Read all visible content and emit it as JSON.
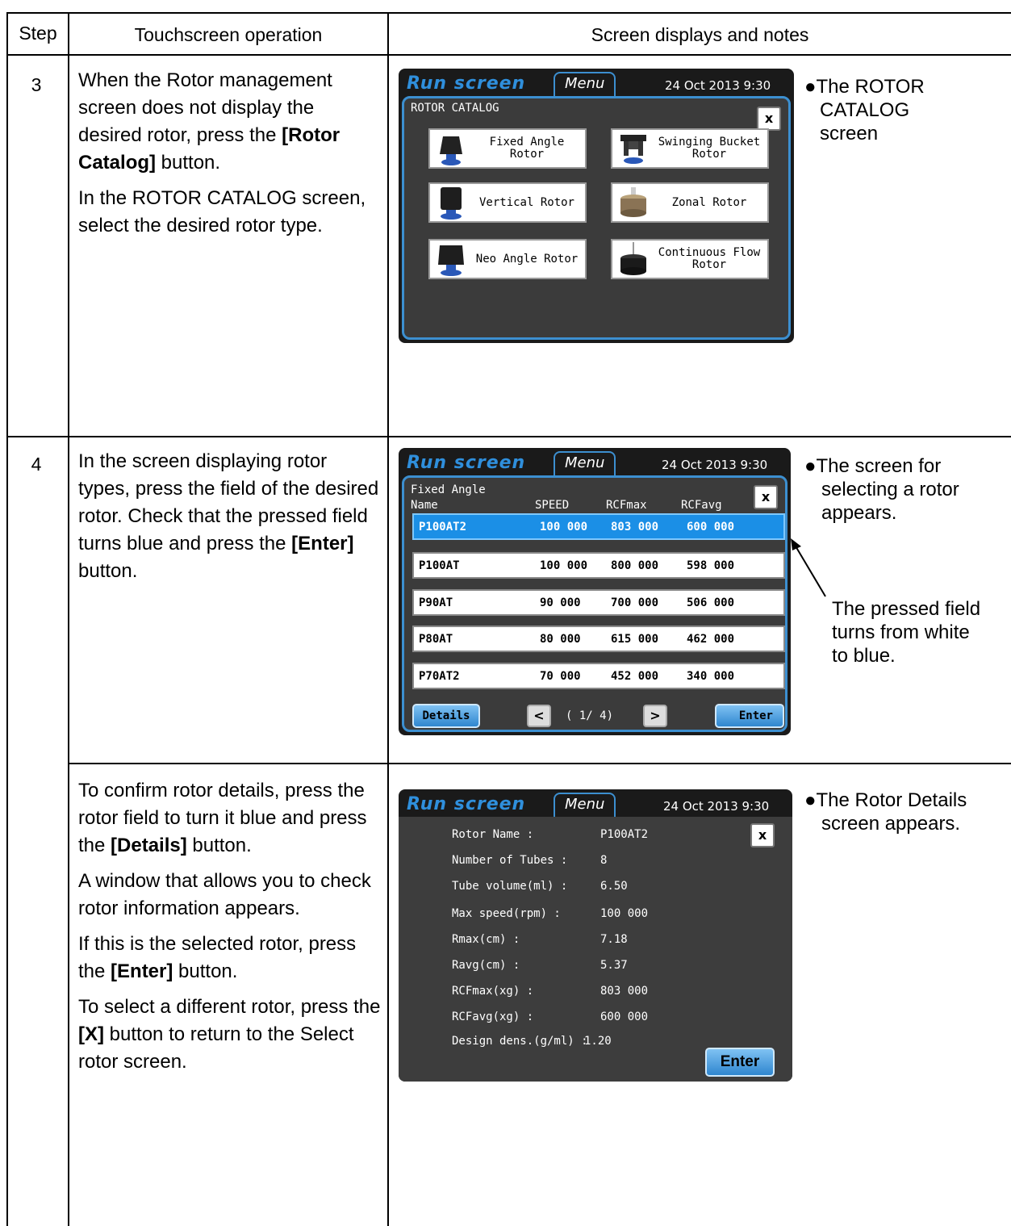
{
  "headers": {
    "step": "Step",
    "operation": "Touchscreen operation",
    "displays": "Screen displays and notes"
  },
  "rows": [
    {
      "step": "3",
      "instructions": [
        [
          "When the Rotor management screen does not display the desired rotor, press the ",
          {
            "b": "[Rotor Catalog]"
          },
          " button."
        ],
        [
          "In the ROTOR CATALOG screen, select the desired rotor type."
        ]
      ],
      "note_lines": [
        "●The ROTOR",
        "CATALOG",
        "screen"
      ]
    },
    {
      "step": "4",
      "instructions": [
        [
          "In the screen displaying rotor types, press the field of the desired rotor. Check that the pressed field turns blue and press the ",
          {
            "b": "[Enter]"
          },
          " button."
        ]
      ],
      "note_lines": [
        "●The screen for",
        "selecting a rotor",
        "appears."
      ],
      "arrow_note_lines": [
        "The pressed field",
        "turns from white",
        "to blue."
      ]
    },
    {
      "step": "",
      "instructions": [
        [
          "To confirm rotor details, press the rotor field to turn it blue and press the ",
          {
            "b": "[Details]"
          },
          " button."
        ],
        [
          "A window that allows you to check rotor information appears."
        ],
        [
          "If this is the selected rotor, press the ",
          {
            "b": "[Enter]"
          },
          " button."
        ],
        [
          "To select a different rotor, press the ",
          {
            "b": "[X]"
          },
          " button to return to the Select rotor screen."
        ]
      ],
      "note_lines": [
        "●The Rotor Details",
        "screen appears."
      ]
    }
  ],
  "screen_common": {
    "tab_run": "Run screen",
    "tab_menu": "Menu",
    "datetime": "24 Oct 2013  9:30",
    "close": "x"
  },
  "catalog": {
    "title": "ROTOR CATALOG",
    "buttons": [
      {
        "label": "Fixed Angle\nRotor",
        "icon": "fixed-angle-rotor-icon"
      },
      {
        "label": "Swinging Bucket\nRotor",
        "icon": "swinging-bucket-rotor-icon"
      },
      {
        "label": "Vertical Rotor",
        "icon": "vertical-rotor-icon"
      },
      {
        "label": "Zonal Rotor",
        "icon": "zonal-rotor-icon"
      },
      {
        "label": "Neo Angle Rotor",
        "icon": "neo-angle-rotor-icon"
      },
      {
        "label": "Continuous Flow\nRotor",
        "icon": "continuous-flow-rotor-icon"
      }
    ]
  },
  "select": {
    "title": "Fixed Angle",
    "columns": [
      "Name",
      "SPEED",
      "RCFmax",
      "RCFavg"
    ],
    "rows": [
      {
        "name": "P100AT2",
        "speed": "100 000",
        "rcfmax": "803 000",
        "rcfavg": "600 000",
        "selected": true
      },
      {
        "name": "P100AT",
        "speed": "100 000",
        "rcfmax": "800 000",
        "rcfavg": "598 000",
        "selected": false
      },
      {
        "name": "P90AT",
        "speed": "90 000",
        "rcfmax": "700 000",
        "rcfavg": "506 000",
        "selected": false
      },
      {
        "name": "P80AT",
        "speed": "80 000",
        "rcfmax": "615 000",
        "rcfavg": "462 000",
        "selected": false
      },
      {
        "name": "P70AT2",
        "speed": "70 000",
        "rcfmax": "452 000",
        "rcfavg": "340 000",
        "selected": false
      }
    ],
    "details_label": "Details",
    "prev": "<",
    "next": ">",
    "page": "( 1/ 4)",
    "enter_label": "Enter"
  },
  "details": {
    "fields": [
      {
        "label": "Rotor Name :",
        "value": "P100AT2"
      },
      {
        "label": "Number of Tubes :",
        "value": "8"
      },
      {
        "label": "Tube volume(ml) :",
        "value": "6.50"
      },
      {
        "label": "Max speed(rpm) :",
        "value": "100 000"
      },
      {
        "label": "Rmax(cm) :",
        "value": "7.18"
      },
      {
        "label": "Ravg(cm) :",
        "value": "5.37"
      },
      {
        "label": "RCFmax(xg) :",
        "value": "803 000"
      },
      {
        "label": "RCFavg(xg) :",
        "value": "600 000"
      },
      {
        "label": "Design dens.(g/ml) :",
        "value": "1.20"
      }
    ],
    "enter_label": "Enter"
  },
  "colors": {
    "accent_blue": "#2f8fdc",
    "selected_row": "#1b8fe6",
    "screen_bg": "#3b3b3b"
  }
}
